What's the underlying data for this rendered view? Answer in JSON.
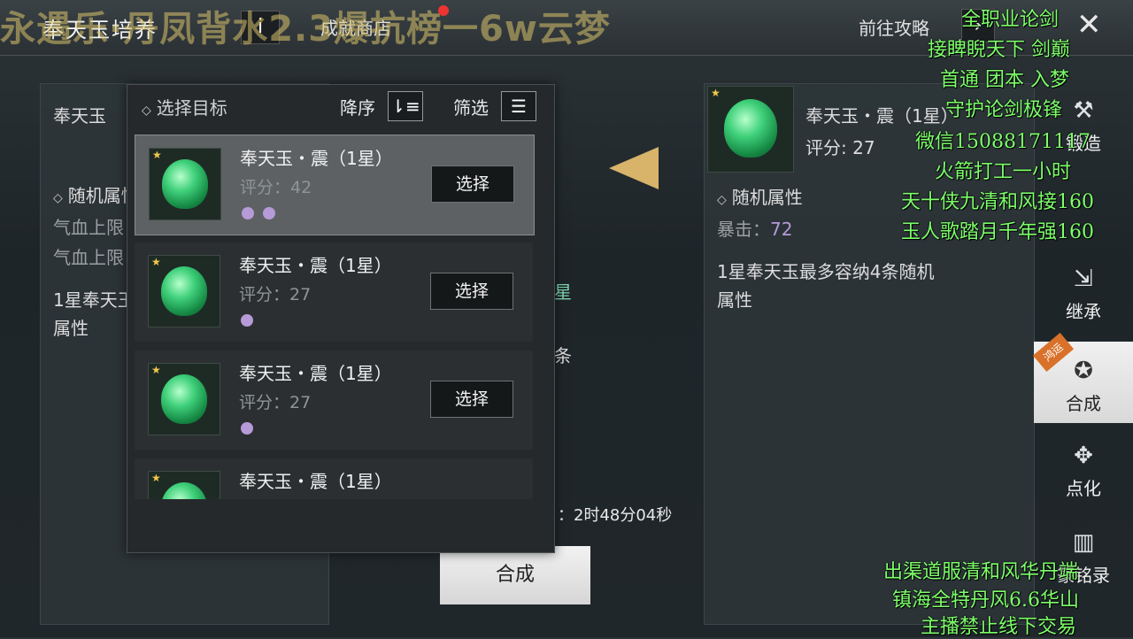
{
  "header": {
    "title": "奉天玉培养",
    "info_icon": "i",
    "shop_label": "成就商店",
    "guide_label": "前往攻略",
    "close_icon": "close-icon"
  },
  "overlay_banner": "永遇乐·丹凤背水2.3爆抗榜一6w云梦",
  "left_panel": {
    "gem_name": "奉天玉",
    "section_title": "随机属性",
    "attr1": "气血上限",
    "attr2": "气血上限",
    "note_line1": "1星奉天玉",
    "note_line2": "属性"
  },
  "center": {
    "star_frag": "星",
    "line_frag": "条",
    "timer": "：2时48分04秒",
    "synth_button": "合成"
  },
  "popup": {
    "title": "选择目标",
    "sort_label": "降序",
    "sort_icon": "⇂≡",
    "filter_label": "筛选",
    "filter_icon": "☰",
    "items": [
      {
        "name": "奉天玉・震（1星）",
        "score": "评分：42",
        "dots": 2,
        "button": "选择",
        "selected": true
      },
      {
        "name": "奉天玉・震（1星）",
        "score": "评分：27",
        "dots": 1,
        "button": "选择",
        "selected": false
      },
      {
        "name": "奉天玉・震（1星）",
        "score": "评分：27",
        "dots": 1,
        "button": "选择",
        "selected": false
      },
      {
        "name": "奉天玉・震（1星）",
        "score": "",
        "dots": 0,
        "button": "",
        "selected": false
      }
    ]
  },
  "right_panel": {
    "gem_name": "奉天玉・震（1星）",
    "score": "评分: 27",
    "section_title": "随机属性",
    "stat_label": "暴击：",
    "stat_value": "72",
    "note_line1": "1星奉天玉最多容纳4条随机",
    "note_line2": "属性"
  },
  "rail": {
    "item1": "锻造",
    "item2": "继承",
    "item3": "合成",
    "item3_badge": "鸿运",
    "item4": "点化",
    "item5": "篆铭录"
  },
  "stream_overlay": {
    "top": [
      "全职业论剑",
      "接睥睨天下 剑巅",
      "首通 团本 入梦",
      "守护论剑极锋",
      "微信15088171117",
      "火箭打工一小时",
      "天十侠九清和风接160",
      "玉人歌踏月千年强160"
    ],
    "bottom": [
      "出渠道服清和风华丹端",
      "镇海全特丹风6.6华山",
      "主播禁止线下交易"
    ]
  },
  "colors": {
    "accent_gold": "#d8b36a",
    "gem_green": "#3fd07a",
    "attr_dot": "#b79ad8",
    "overlay_green": "#7dff6a"
  }
}
